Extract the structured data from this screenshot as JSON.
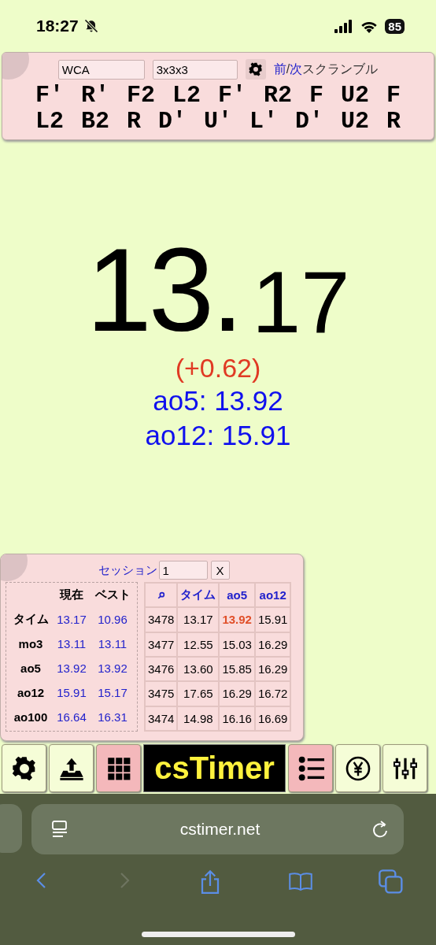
{
  "status_bar": {
    "time": "18:27",
    "silent": true,
    "battery": "85"
  },
  "scramble_panel": {
    "type_field": {
      "value": "WCA"
    },
    "puzzle_field": {
      "value": "3x3x3"
    },
    "prev_link": "前",
    "slash": "/",
    "next_link": "次",
    "scramble_label": "スクランブル",
    "lines": [
      "F' R' F2 L2 F' R2 F U2 F",
      "L2 B2 R D' U' L' D' U2 R"
    ]
  },
  "timer": {
    "whole": "13.",
    "fraction": "17",
    "delta": "(+0.62)",
    "averages": [
      "ao5: 13.92",
      "ao12: 15.91"
    ]
  },
  "stats_panel": {
    "session_label": "セッション",
    "session_field": {
      "value": "1"
    },
    "clear_button": "X",
    "summary": {
      "columns": [
        "現在",
        "ベスト"
      ],
      "rows": [
        {
          "label": "タイム",
          "current": "13.17",
          "best": "10.96"
        },
        {
          "label": "mo3",
          "current": "13.11",
          "best": "13.11"
        },
        {
          "label": "ao5",
          "current": "13.92",
          "best": "13.92"
        },
        {
          "label": "ao12",
          "current": "15.91",
          "best": "15.17"
        },
        {
          "label": "ao100",
          "current": "16.64",
          "best": "16.31"
        }
      ]
    },
    "table": {
      "columns": [
        "タイム",
        "ao5",
        "ao12"
      ],
      "rows": [
        {
          "no": "3478",
          "time": "13.17",
          "ao5": "13.92",
          "ao12": "15.91",
          "ao5_best": true
        },
        {
          "no": "3477",
          "time": "12.55",
          "ao5": "15.03",
          "ao12": "16.29",
          "ao5_best": false
        },
        {
          "no": "3476",
          "time": "13.60",
          "ao5": "15.85",
          "ao12": "16.29",
          "ao5_best": false
        },
        {
          "no": "3475",
          "time": "17.65",
          "ao5": "16.29",
          "ao12": "16.72",
          "ao5_best": false
        },
        {
          "no": "3474",
          "time": "14.98",
          "ao5": "16.16",
          "ao12": "16.69",
          "ao5_best": false
        }
      ]
    }
  },
  "toolbar": [
    {
      "kind": "settings",
      "selected": false
    },
    {
      "kind": "export",
      "selected": false
    },
    {
      "kind": "grid",
      "selected": true
    },
    {
      "kind": "logo",
      "label": "csTimer",
      "selected": false
    },
    {
      "kind": "list",
      "selected": true
    },
    {
      "kind": "donate",
      "selected": false
    },
    {
      "kind": "tools",
      "selected": false
    }
  ],
  "browser": {
    "url": "cstimer.net",
    "back_enabled": true,
    "forward_enabled": false
  }
}
